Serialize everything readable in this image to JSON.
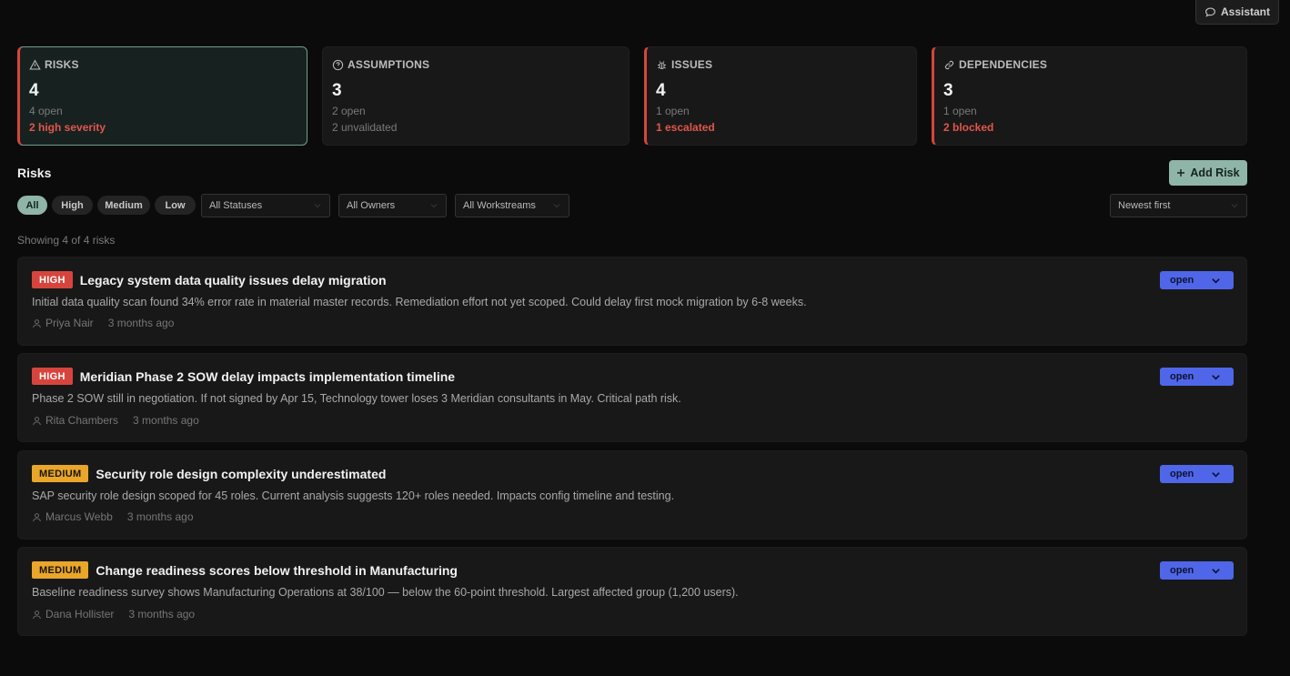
{
  "assistant": {
    "label": "Assistant"
  },
  "cards": [
    {
      "title": "RISKS",
      "count": "4",
      "sub": "4 open",
      "alert": "2 high severity",
      "sub2": ""
    },
    {
      "title": "ASSUMPTIONS",
      "count": "3",
      "sub": "2 open",
      "alert": "",
      "sub2": "2 unvalidated"
    },
    {
      "title": "ISSUES",
      "count": "4",
      "sub": "1 open",
      "alert": "1 escalated",
      "sub2": ""
    },
    {
      "title": "DEPENDENCIES",
      "count": "3",
      "sub": "1 open",
      "alert": "2 blocked",
      "sub2": ""
    }
  ],
  "section": {
    "title": "Risks",
    "add_label": "Add Risk"
  },
  "filters": {
    "severity": [
      "All",
      "High",
      "Medium",
      "Low"
    ],
    "status": "All Statuses",
    "owner": "All Owners",
    "workstream": "All Workstreams",
    "sort": "Newest first"
  },
  "showing": "Showing 4 of 4 risks",
  "risks": [
    {
      "severity": "HIGH",
      "title": "Legacy system data quality issues delay migration",
      "description": "Initial data quality scan found 34% error rate in material master records. Remediation effort not yet scoped. Could delay first mock migration by 6-8 weeks.",
      "owner": "Priya Nair",
      "time": "3 months ago",
      "status": "open"
    },
    {
      "severity": "HIGH",
      "title": "Meridian Phase 2 SOW delay impacts implementation timeline",
      "description": "Phase 2 SOW still in negotiation. If not signed by Apr 15, Technology tower loses 3 Meridian consultants in May. Critical path risk.",
      "owner": "Rita Chambers",
      "time": "3 months ago",
      "status": "open"
    },
    {
      "severity": "MEDIUM",
      "title": "Security role design complexity underestimated",
      "description": "SAP security role design scoped for 45 roles. Current analysis suggests 120+ roles needed. Impacts config timeline and testing.",
      "owner": "Marcus Webb",
      "time": "3 months ago",
      "status": "open"
    },
    {
      "severity": "MEDIUM",
      "title": "Change readiness scores below threshold in Manufacturing",
      "description": "Baseline readiness survey shows Manufacturing Operations at 38/100 — below the 60-point threshold. Largest affected group (1,200 users).",
      "owner": "Dana Hollister",
      "time": "3 months ago",
      "status": "open"
    }
  ]
}
